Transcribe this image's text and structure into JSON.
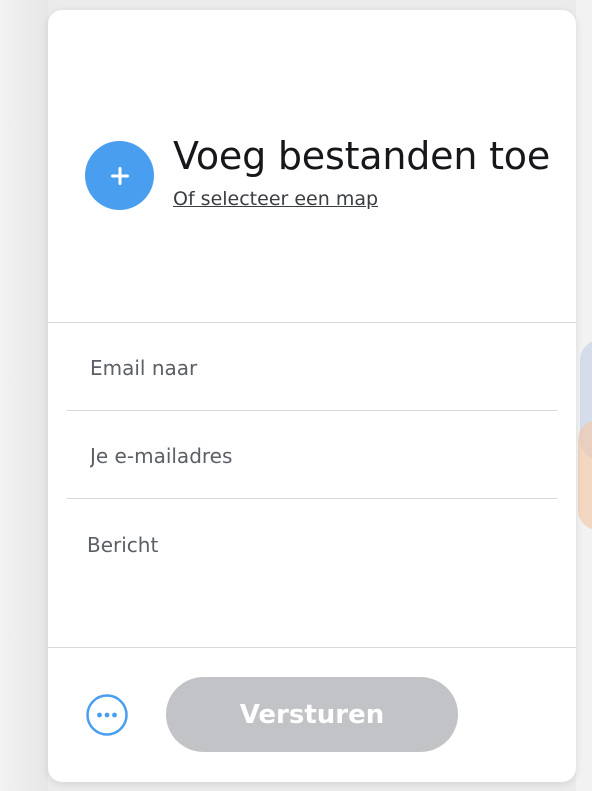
{
  "upload": {
    "title": "Voeg bestanden toe",
    "select_folder_link": "Of selecteer een map",
    "add_icon": "plus-icon"
  },
  "form": {
    "email_to_placeholder": "Email naar",
    "email_from_placeholder": "Je e-mailadres",
    "message_placeholder": "Bericht"
  },
  "footer": {
    "options_icon": "more-options-icon",
    "send_label": "Versturen"
  },
  "colors": {
    "accent": "#4a9ef0",
    "send_disabled": "#c2c3c6",
    "divider": "#d8d9dc"
  }
}
